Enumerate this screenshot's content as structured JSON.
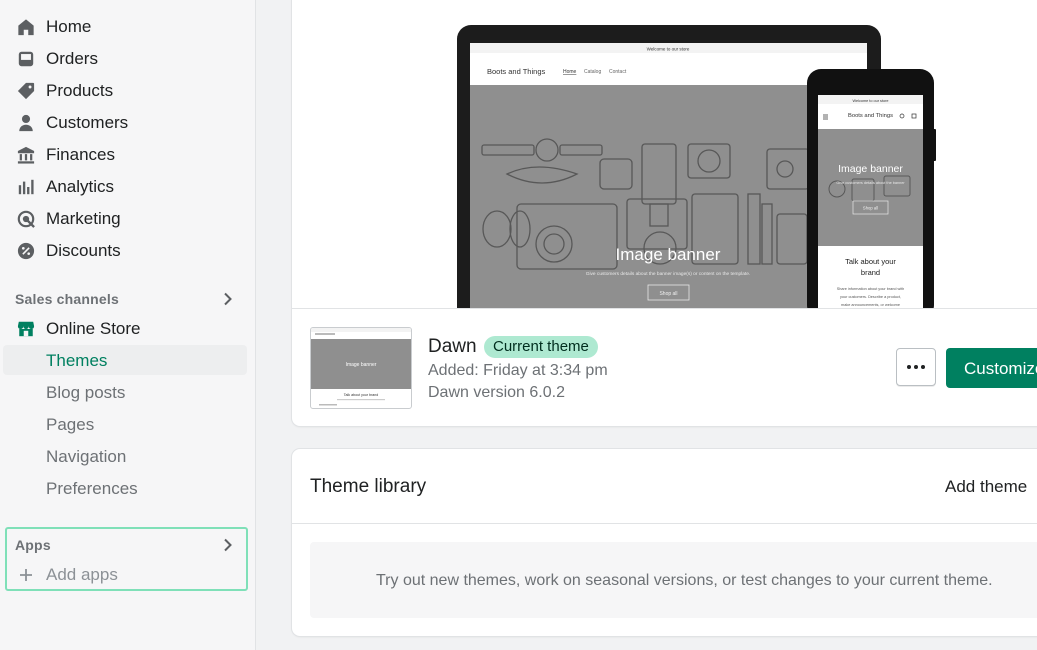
{
  "sidebar": {
    "nav": [
      {
        "label": "Home",
        "icon": "home-icon"
      },
      {
        "label": "Orders",
        "icon": "orders-icon"
      },
      {
        "label": "Products",
        "icon": "tag-icon"
      },
      {
        "label": "Customers",
        "icon": "person-icon"
      },
      {
        "label": "Finances",
        "icon": "bank-icon"
      },
      {
        "label": "Analytics",
        "icon": "bar-chart-icon"
      },
      {
        "label": "Marketing",
        "icon": "target-icon"
      },
      {
        "label": "Discounts",
        "icon": "discount-icon"
      }
    ],
    "sales_channels": {
      "label": "Sales channels",
      "store": {
        "label": "Online Store",
        "icon": "store-icon"
      },
      "sub_items": [
        {
          "label": "Themes",
          "active": true
        },
        {
          "label": "Blog posts"
        },
        {
          "label": "Pages"
        },
        {
          "label": "Navigation"
        },
        {
          "label": "Preferences"
        }
      ]
    },
    "apps": {
      "label": "Apps",
      "add_label": "Add apps"
    }
  },
  "current_theme": {
    "preview": {
      "tablet": {
        "announcement": "Welcome to our store",
        "store_name": "Boots and Things",
        "nav_links": [
          "Home",
          "Catalog",
          "Contact"
        ],
        "banner_title": "Image banner",
        "banner_text": "Give customers details about the banner image(s) or content on the template.",
        "banner_button": "Shop all"
      },
      "phone": {
        "announcement": "Welcome to our store",
        "store_name": "Boots and Things",
        "banner_title": "Image banner",
        "banner_text": "Give customers details about the banner",
        "banner_button": "Shop all",
        "section_title": "Talk about your brand",
        "section_text": "Share information about your brand with your customers. Describe a product, make announcements, or welcome"
      }
    },
    "thumbnail": {
      "banner_title": "Image banner",
      "section_title": "Talk about your brand"
    },
    "name": "Dawn",
    "badge": "Current theme",
    "added": "Added: Friday at 3:34 pm",
    "version": "Dawn version 6.0.2",
    "more_label": "•••",
    "customize_label": "Customize"
  },
  "theme_library": {
    "title": "Theme library",
    "add_theme_label": "Add theme",
    "empty_text": "Try out new themes, work on seasonal versions, or test changes to your current theme."
  },
  "colors": {
    "accent": "#008060",
    "badge_bg": "#aee9d1",
    "highlight_border": "#7fe0b8"
  }
}
